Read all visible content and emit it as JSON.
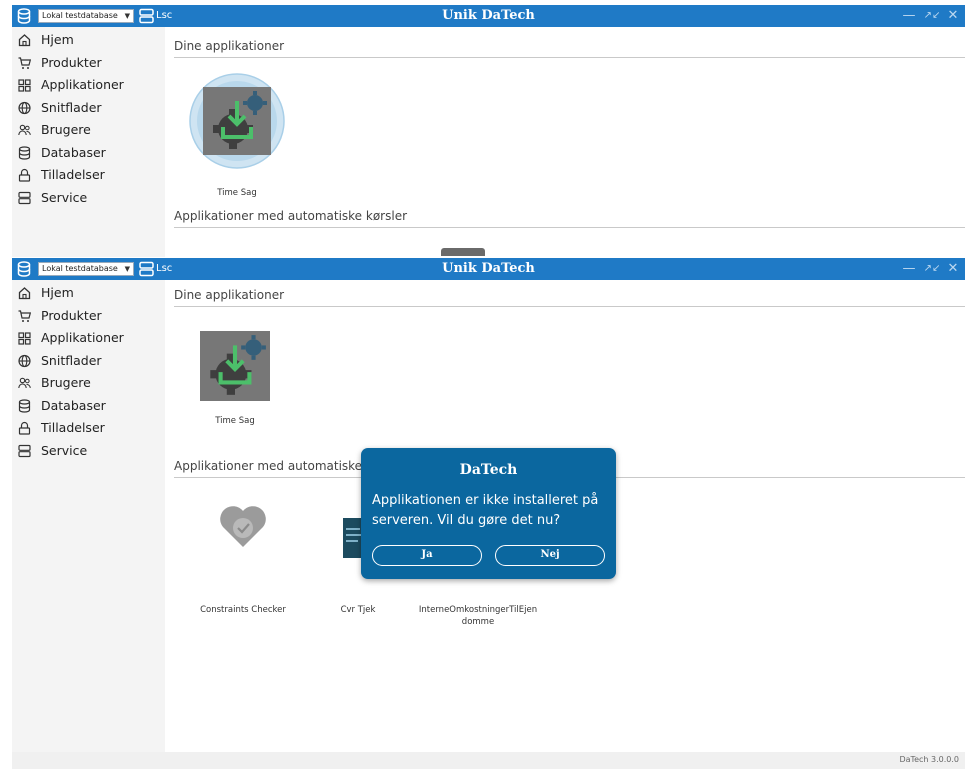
{
  "app": {
    "title": "Unik DaTech",
    "database_select": "Lokal testdatabase",
    "server_label": "Lsc",
    "version": "DaTech 3.0.0.0"
  },
  "sidebar": {
    "items": [
      {
        "label": "Hjem",
        "icon": "home-icon"
      },
      {
        "label": "Produkter",
        "icon": "cart-icon"
      },
      {
        "label": "Applikationer",
        "icon": "grid-icon"
      },
      {
        "label": "Snitflader",
        "icon": "globe-icon"
      },
      {
        "label": "Brugere",
        "icon": "users-icon"
      },
      {
        "label": "Databaser",
        "icon": "database-icon"
      },
      {
        "label": "Tilladelser",
        "icon": "lock-icon"
      },
      {
        "label": "Service",
        "icon": "server-icon"
      }
    ]
  },
  "main": {
    "section_apps": "Dine applikationer",
    "section_auto": "Applikationer med automatiske kørsler",
    "section_auto_truncated": "Applikationer med automatiske kø",
    "apps": [
      {
        "label": "Time Sag"
      }
    ],
    "auto_apps": [
      {
        "label": "Constraints Checker"
      },
      {
        "label": "Cvr Tjek"
      },
      {
        "label": "InterneOmkostningerTilEjen"
      },
      {
        "label": "domme"
      }
    ]
  },
  "dialog": {
    "title": "DaTech",
    "message": "Applikationen er ikke installeret på serveren. Vil du gøre det nu?",
    "yes_label": "Ja",
    "no_label": "Nej"
  },
  "colors": {
    "titlebar": "#1f7ac6",
    "dialog": "#0b679f",
    "app_icon_bg": "#6f6f6f",
    "app_icon_arrow": "#4cbf6a",
    "constraint_icon": "#9b9b9b"
  }
}
